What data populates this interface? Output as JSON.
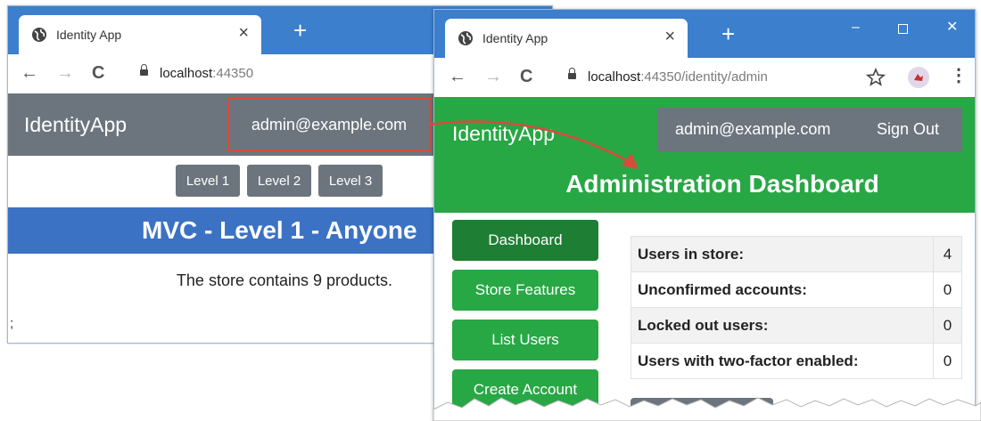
{
  "back_window": {
    "tab": {
      "title": "Identity App",
      "close": "×"
    },
    "new_tab": "+",
    "nav": {
      "back": "←",
      "forward": "→",
      "reload": "C"
    },
    "address": {
      "host": "localhost",
      "port": ":44350",
      "path": ""
    },
    "navbar": {
      "brand": "IdentityApp",
      "user": "admin@example.com"
    },
    "level_buttons": [
      "Level 1",
      "Level 2",
      "Level 3"
    ],
    "banner": "MVC - Level 1 - Anyone",
    "body_text": "The store contains 9 products.",
    "stray_text": ";"
  },
  "front_window": {
    "tab": {
      "title": "Identity App",
      "close": "×"
    },
    "new_tab": "+",
    "window_controls": {
      "minimize": "–",
      "close": "✕"
    },
    "nav": {
      "back": "←",
      "forward": "→",
      "reload": "C"
    },
    "address": {
      "host": "localhost",
      "port": ":44350",
      "path": "/identity/admin"
    },
    "header": {
      "brand": "IdentityApp",
      "user": "admin@example.com",
      "sign_out": "Sign Out",
      "title": "Administration Dashboard"
    },
    "sidebar": [
      {
        "label": "Dashboard",
        "active": true
      },
      {
        "label": "Store Features",
        "active": false
      },
      {
        "label": "List Users",
        "active": false
      },
      {
        "label": "Create Account",
        "active": false
      }
    ],
    "stats": [
      {
        "label": "Users in store:",
        "value": "4"
      },
      {
        "label": "Unconfirmed accounts:",
        "value": "0"
      },
      {
        "label": "Locked out users:",
        "value": "0"
      },
      {
        "label": "Users with two-factor enabled:",
        "value": "0"
      }
    ]
  },
  "colors": {
    "chrome_blue": "#3b7fcd",
    "navbar_gray": "#6c757d",
    "banner_blue": "#3b72c4",
    "success_green": "#28a745",
    "active_green": "#1e7e34",
    "highlight_red": "#d94a3d"
  },
  "icons": [
    "globe-icon",
    "close-icon",
    "plus-icon",
    "back-arrow-icon",
    "forward-arrow-icon",
    "reload-icon",
    "lock-icon",
    "star-icon",
    "extension-icon",
    "kebab-menu-icon",
    "minimize-icon",
    "maximize-icon"
  ]
}
